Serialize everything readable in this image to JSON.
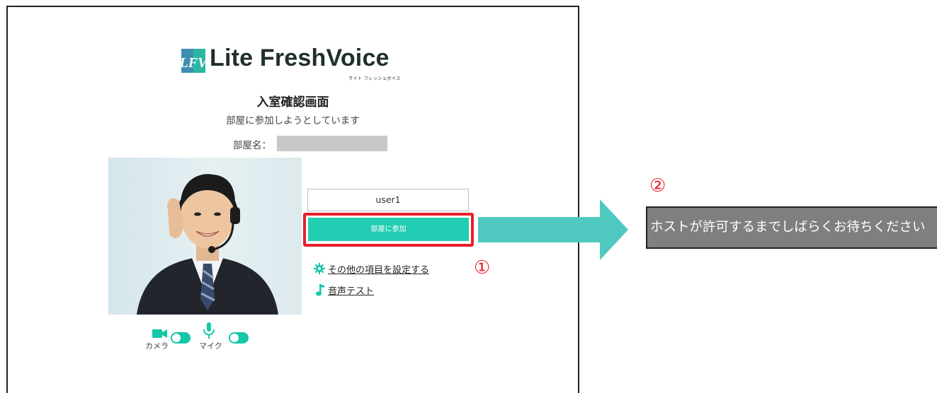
{
  "logo": {
    "wordmark": "Lite FreshVoice",
    "kana": "ライト フレッシュボイス",
    "mark_letters": "LFV"
  },
  "dialog": {
    "title": "入室確認画面",
    "subtitle": "部屋に参加しようとしています",
    "room_label": "部屋名：",
    "room_name": ""
  },
  "preview": {
    "camera_label": "カメラ",
    "mic_label": "マイク",
    "camera_on": true,
    "mic_on": true
  },
  "form": {
    "username": "user1",
    "join_button": "部屋に参加"
  },
  "links": {
    "settings": "その他の項目を設定する",
    "audio_test": "音声テスト"
  },
  "steps": {
    "step1": "①",
    "step2": "②"
  },
  "waiting": {
    "message": "ホストが許可するまでしばらくお待ちください"
  },
  "colors": {
    "accent": "#23cdb3",
    "highlight": "#e8202a",
    "arrow": "#4fc9c0",
    "wait_bg": "#7f7f7f"
  }
}
